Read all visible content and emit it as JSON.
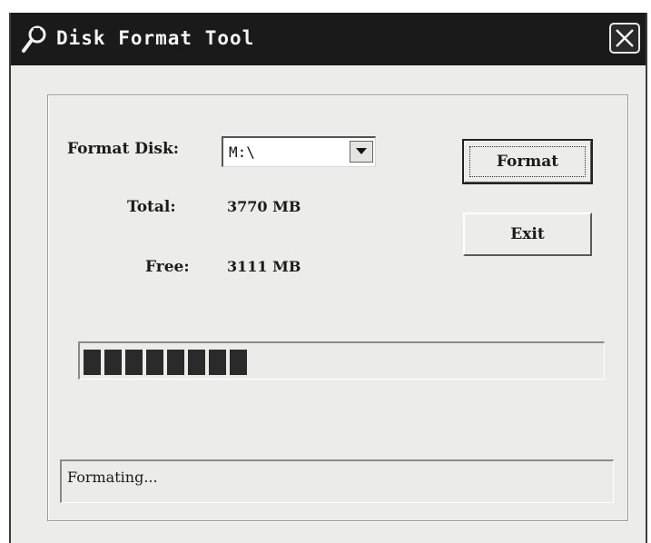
{
  "window": {
    "title": "Disk Format Tool",
    "title_icon": "wrench-icon",
    "close_icon": "close-icon"
  },
  "form": {
    "format_disk_label": "Format Disk:",
    "selected_drive": "M:\\",
    "total_label": "Total:",
    "total_value": "3770 MB",
    "free_label": "Free:",
    "free_value": "3111 MB"
  },
  "buttons": {
    "format_label": "Format",
    "exit_label": "Exit"
  },
  "progress": {
    "fraction": 0.33
  },
  "status": {
    "text": "Formating..."
  },
  "colors": {
    "titlebar": "#1a1a1a",
    "window_bg": "#ececea",
    "progress_block": "#2a2a2a"
  }
}
